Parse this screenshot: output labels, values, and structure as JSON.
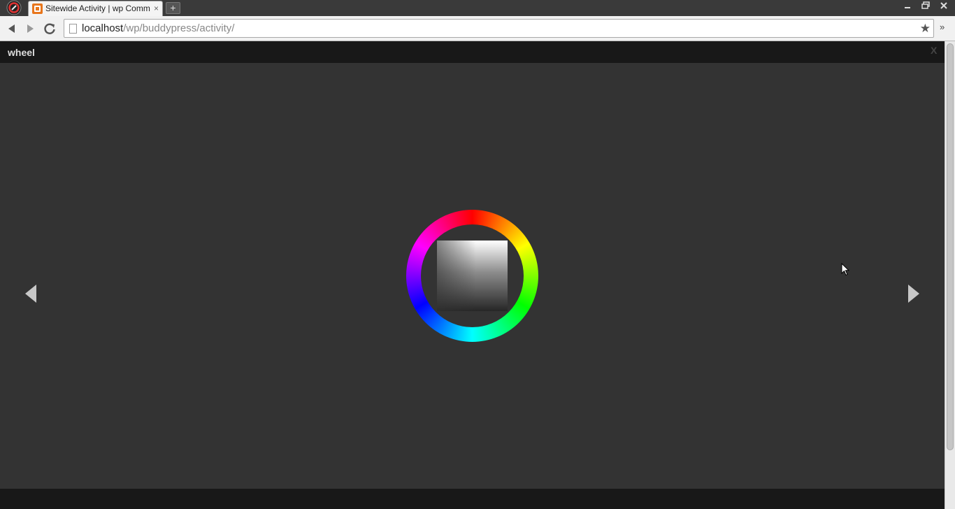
{
  "browser": {
    "tab_title": "Sitewide Activity | wp Comm",
    "tab_close": "×",
    "new_tab": "+",
    "url_host": "localhost",
    "url_path": "/wp/buddypress/activity/",
    "bookmark_icon": "star-icon",
    "overflow": "»"
  },
  "lightbox": {
    "title": "wheel",
    "close": "X",
    "prev_icon": "left-arrow-icon",
    "next_icon": "right-arrow-icon"
  },
  "colors": {
    "chrome_dark": "#3a3a3a",
    "page_bg": "#333333",
    "header_bg": "#181818"
  }
}
